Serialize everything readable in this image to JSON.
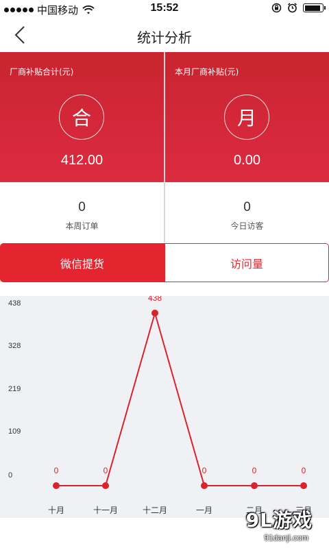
{
  "status_bar": {
    "carrier": "中国移动",
    "time": "15:52",
    "wifi_icon": "wifi-icon",
    "battery_level": 0.9
  },
  "nav": {
    "title": "统计分析",
    "back_icon": "chevron-left-icon"
  },
  "summary": {
    "left": {
      "label": "厂商补贴合计(元)",
      "badge": "合",
      "value": "412.00"
    },
    "right": {
      "label": "本月厂商补贴(元)",
      "badge": "月",
      "value": "0.00"
    }
  },
  "stats": {
    "left": {
      "value": "0",
      "label": "本周订单"
    },
    "right": {
      "value": "0",
      "label": "今日访客"
    }
  },
  "tabs": [
    {
      "label": "微信提货",
      "active": true
    },
    {
      "label": "访问量",
      "active": false
    }
  ],
  "colors": {
    "accent": "#e4242e",
    "chart_line": "#d9232d",
    "chart_bg": "#eff1f5"
  },
  "chart_data": {
    "type": "line",
    "categories": [
      "十月",
      "十一月",
      "十二月",
      "一月",
      "二月",
      "三月"
    ],
    "values": [
      0,
      0,
      438,
      0,
      0,
      0
    ],
    "data_labels": [
      "0",
      "0",
      "438",
      "0",
      "0",
      "0"
    ],
    "y_ticks": [
      "438",
      "328",
      "219",
      "109",
      "0"
    ],
    "ylim": [
      0,
      438
    ],
    "grid": false,
    "legend": "none"
  },
  "watermark": {
    "logo": "9L游戏",
    "url": "91danji.com"
  }
}
